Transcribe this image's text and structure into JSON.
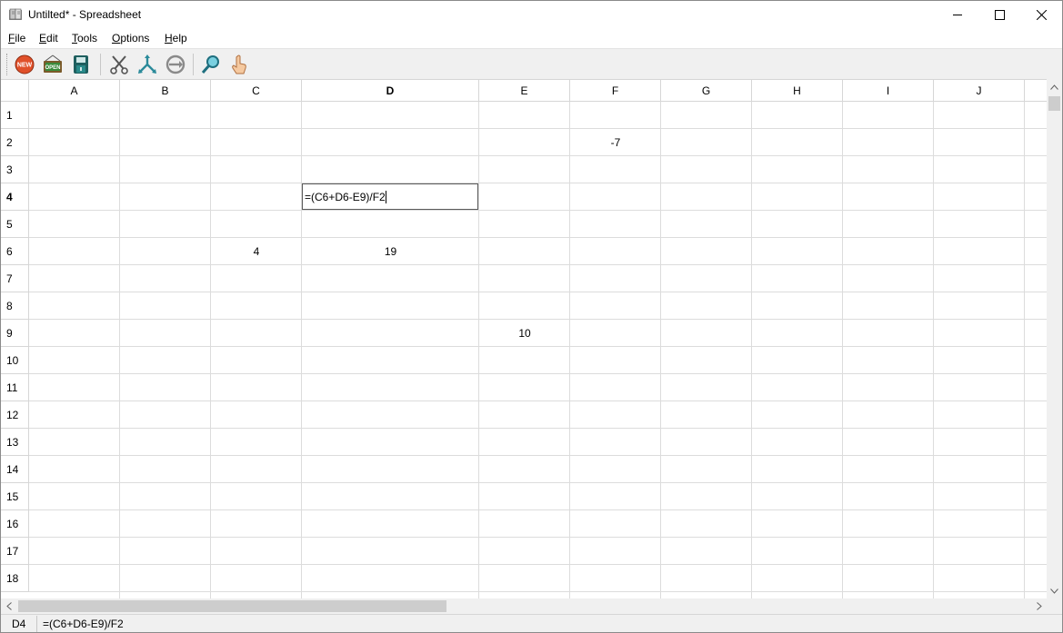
{
  "window": {
    "title": "Untilted* - Spreadsheet"
  },
  "menu": [
    {
      "accel": "F",
      "rest": "ile"
    },
    {
      "accel": "E",
      "rest": "dit"
    },
    {
      "accel": "T",
      "rest": "ools"
    },
    {
      "accel": "O",
      "rest": "ptions"
    },
    {
      "accel": "H",
      "rest": "elp"
    }
  ],
  "toolbar": {
    "new_icon_text": "NEW",
    "open_icon_text": "OPEN",
    "icons": [
      "new-icon",
      "open-icon",
      "save-icon",
      "cut-icon",
      "copy-icon",
      "paste-icon",
      "find-icon",
      "help-pointer-icon"
    ]
  },
  "columns": [
    "A",
    "B",
    "C",
    "D",
    "E",
    "F",
    "G",
    "H",
    "I",
    "J"
  ],
  "rows": [
    "1",
    "2",
    "3",
    "4",
    "5",
    "6",
    "7",
    "8",
    "9",
    "10",
    "11",
    "12",
    "13",
    "14",
    "15",
    "16",
    "17",
    "18"
  ],
  "selected": {
    "column": "D",
    "row": "4"
  },
  "cells": {
    "F2": "-7",
    "C6": "4",
    "D6": "19",
    "E9": "10"
  },
  "editor": {
    "cell": "D4",
    "value": "=(C6+D6-E9)/F2"
  },
  "status": {
    "cell_ref": "D4",
    "formula": "=(C6+D6-E9)/F2"
  },
  "colors": {
    "gridline": "#dcdcdc",
    "toolbar_bg": "#f0f0f0",
    "new_icon": "#e0502a",
    "open_icon": "#3a8a3a",
    "save_icon": "#2a7a7a",
    "tool_teal": "#2a8a9a"
  }
}
